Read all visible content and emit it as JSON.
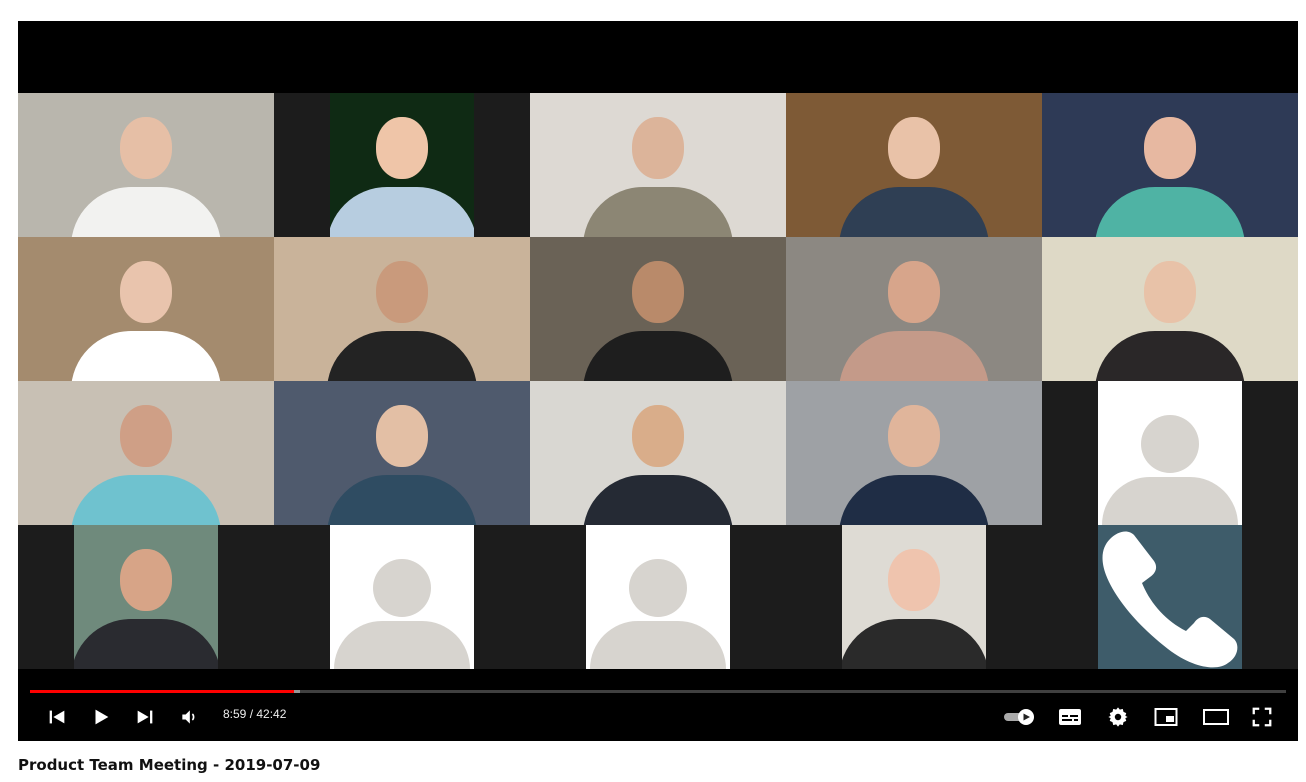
{
  "video": {
    "title": "Product Team Meeting - 2019-07-09",
    "current_time": "8:59",
    "duration": "42:42",
    "time_display": "8:59 / 42:42",
    "progress_fraction": 0.21,
    "buffered_fraction": 0.215
  },
  "controls": {
    "previous": "skip-previous-icon",
    "play": "play-icon",
    "next": "skip-next-icon",
    "volume": "volume-icon",
    "autoplay": "autoplay-toggle-icon",
    "subtitles": "subtitles-icon",
    "settings": "gear-icon",
    "miniplayer": "miniplayer-icon",
    "theater": "theater-mode-icon",
    "fullscreen": "fullscreen-icon"
  },
  "colors": {
    "progress_played": "#ff0000",
    "tile_gap": "#1c1c1c",
    "placeholder_avatar": "#d7d4cf",
    "phone_tile": "#3e5c6a"
  },
  "participants": [
    {
      "kind": "video",
      "bg": "#b9b6ad",
      "skin": "#e6bfa6",
      "shirt": "#f2f2f0"
    },
    {
      "kind": "video",
      "bg": "#0f2a14",
      "skin": "#efc5a8",
      "shirt": "#b7cde0"
    },
    {
      "kind": "video",
      "bg": "#ddd9d3",
      "skin": "#dcb49a",
      "shirt": "#8c8674"
    },
    {
      "kind": "video",
      "bg": "#7e5a36",
      "skin": "#e9c2a8",
      "shirt": "#2f3f54"
    },
    {
      "kind": "video",
      "bg": "#2e3a56",
      "skin": "#e7b8a1",
      "shirt": "#4fb3a4"
    },
    {
      "kind": "video",
      "bg": "#a48b6e",
      "skin": "#e9c4ad",
      "shirt": "#ffffff"
    },
    {
      "kind": "video",
      "bg": "#c9b39a",
      "skin": "#c99a7c",
      "shirt": "#232323"
    },
    {
      "kind": "video",
      "bg": "#6a6256",
      "skin": "#b98a6a",
      "shirt": "#1e1e1e"
    },
    {
      "kind": "video",
      "bg": "#8c8882",
      "skin": "#d7a58b",
      "shirt": "#c49a89"
    },
    {
      "kind": "video",
      "bg": "#ded9c6",
      "skin": "#e8c2a8",
      "shirt": "#2a2728"
    },
    {
      "kind": "video",
      "bg": "#c8c0b4",
      "skin": "#cf9f86",
      "shirt": "#6fc2cf"
    },
    {
      "kind": "video",
      "bg": "#4f5a6d",
      "skin": "#e3bfa5",
      "shirt": "#2f4c62"
    },
    {
      "kind": "video",
      "bg": "#d9d7d2",
      "skin": "#d9ad8a",
      "shirt": "#252a34"
    },
    {
      "kind": "video",
      "bg": "#9ea1a5",
      "skin": "#e0b59b",
      "shirt": "#1f2d45"
    },
    {
      "kind": "placeholder"
    },
    {
      "kind": "video",
      "bg": "#6f8a7c",
      "skin": "#d7a487",
      "shirt": "#2a2b30"
    },
    {
      "kind": "placeholder"
    },
    {
      "kind": "placeholder"
    },
    {
      "kind": "video",
      "bg": "#dedbd4",
      "skin": "#efc4ae",
      "shirt": "#2a2a2a"
    },
    {
      "kind": "phone",
      "icon": "phone-icon"
    }
  ]
}
